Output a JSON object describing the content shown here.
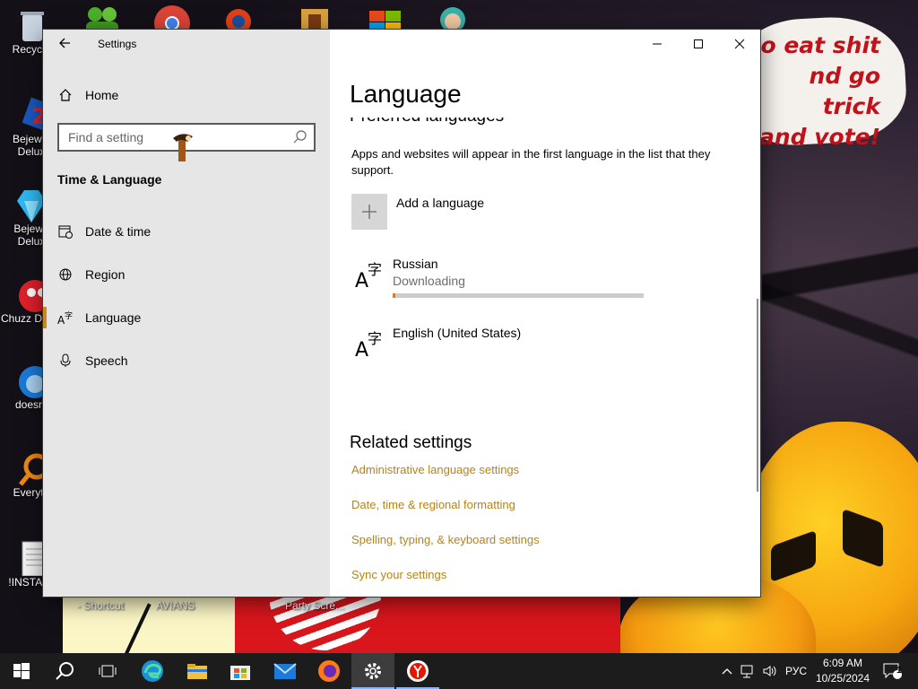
{
  "window": {
    "title": "Settings",
    "controls": {
      "minimize": "minimize",
      "maximize": "maximize",
      "close": "close"
    }
  },
  "sidebar": {
    "home_label": "Home",
    "search_placeholder": "Find a setting",
    "section_title": "Time & Language",
    "items": [
      {
        "label": "Date & time",
        "icon": "calendar-clock-icon",
        "active": false
      },
      {
        "label": "Region",
        "icon": "globe-icon",
        "active": false
      },
      {
        "label": "Language",
        "icon": "language-icon",
        "active": true
      },
      {
        "label": "Speech",
        "icon": "microphone-icon",
        "active": false
      }
    ]
  },
  "main": {
    "page_title": "Language",
    "partial_heading": "Preferred languages",
    "description": "Apps and websites will appear in the first language in the list that they support.",
    "add_language_label": "Add a language",
    "languages": [
      {
        "name": "Russian",
        "status": "Downloading",
        "progress": 0.01
      },
      {
        "name": "English (United States)",
        "status": ""
      }
    ],
    "related_title": "Related settings",
    "links": [
      "Administrative language settings",
      "Date, time & regional formatting",
      "Spelling, typing, & keyboard settings",
      "Sync your settings"
    ]
  },
  "desktop": {
    "icons": [
      {
        "label": "Recycle"
      },
      {
        "label": "Bejewel Delux"
      },
      {
        "label": "Bejewe Delux"
      },
      {
        "label": "Chuzz Delux"
      },
      {
        "label": "doesnt"
      },
      {
        "label": "Everyth"
      },
      {
        "label": "!INSTALL"
      }
    ],
    "bottom_labels": [
      "- Shortcut",
      "AVIANS",
      "Party Scre..."
    ],
    "wallpaper_text": [
      "o eat shit",
      "nd go trick",
      "and vote!"
    ]
  },
  "taskbar": {
    "pinned": [
      "start-icon",
      "search-icon",
      "task-view-icon",
      "edge-icon",
      "file-explorer-icon",
      "store-icon",
      "mail-icon",
      "firefox-icon",
      "settings-icon",
      "yandex-browser-icon"
    ],
    "tray": {
      "language": "РУС",
      "time": "6:09 AM",
      "date": "10/25/2024",
      "notification_count": "1"
    }
  },
  "colors": {
    "accent": "#b58418",
    "active_marker": "#c88a1c",
    "progress": "#e07830",
    "sidebar_bg": "#e6e6e6"
  }
}
